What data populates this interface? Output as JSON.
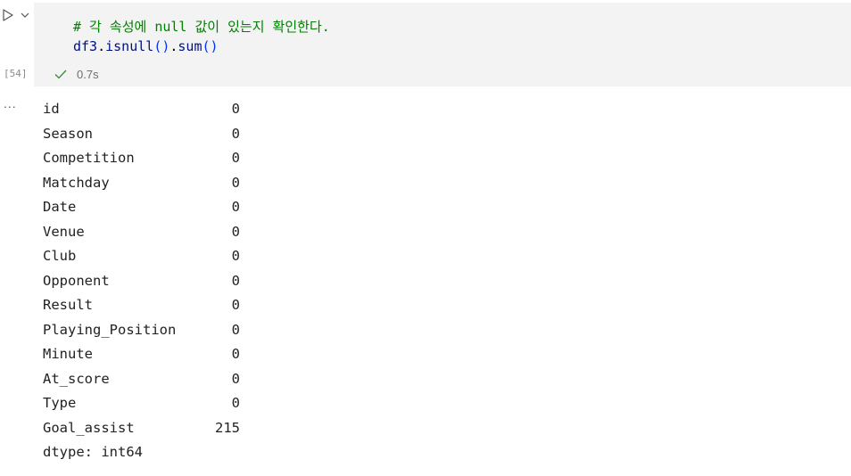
{
  "cell": {
    "execution_count": "[54]",
    "status": "0.7s",
    "code": {
      "comment": "# 각 속성에 null 값이 있는지 확인한다.",
      "var": "df3",
      "dot1": ".",
      "method1": "isnull",
      "parens1": "()",
      "dot2": ".",
      "method2": "sum",
      "parens2": "()"
    }
  },
  "output": {
    "menu": "...",
    "rows": [
      {
        "key": "id",
        "value": "0"
      },
      {
        "key": "Season",
        "value": "0"
      },
      {
        "key": "Competition",
        "value": "0"
      },
      {
        "key": "Matchday",
        "value": "0"
      },
      {
        "key": "Date",
        "value": "0"
      },
      {
        "key": "Venue",
        "value": "0"
      },
      {
        "key": "Club",
        "value": "0"
      },
      {
        "key": "Opponent",
        "value": "0"
      },
      {
        "key": "Result",
        "value": "0"
      },
      {
        "key": "Playing_Position",
        "value": "0"
      },
      {
        "key": "Minute",
        "value": "0"
      },
      {
        "key": "At_score",
        "value": "0"
      },
      {
        "key": "Type",
        "value": "0"
      },
      {
        "key": "Goal_assist",
        "value": "215"
      }
    ],
    "dtype": "dtype: int64"
  },
  "icons": {
    "run": "play-icon",
    "expand": "chevron-down-icon",
    "success": "check-icon"
  }
}
